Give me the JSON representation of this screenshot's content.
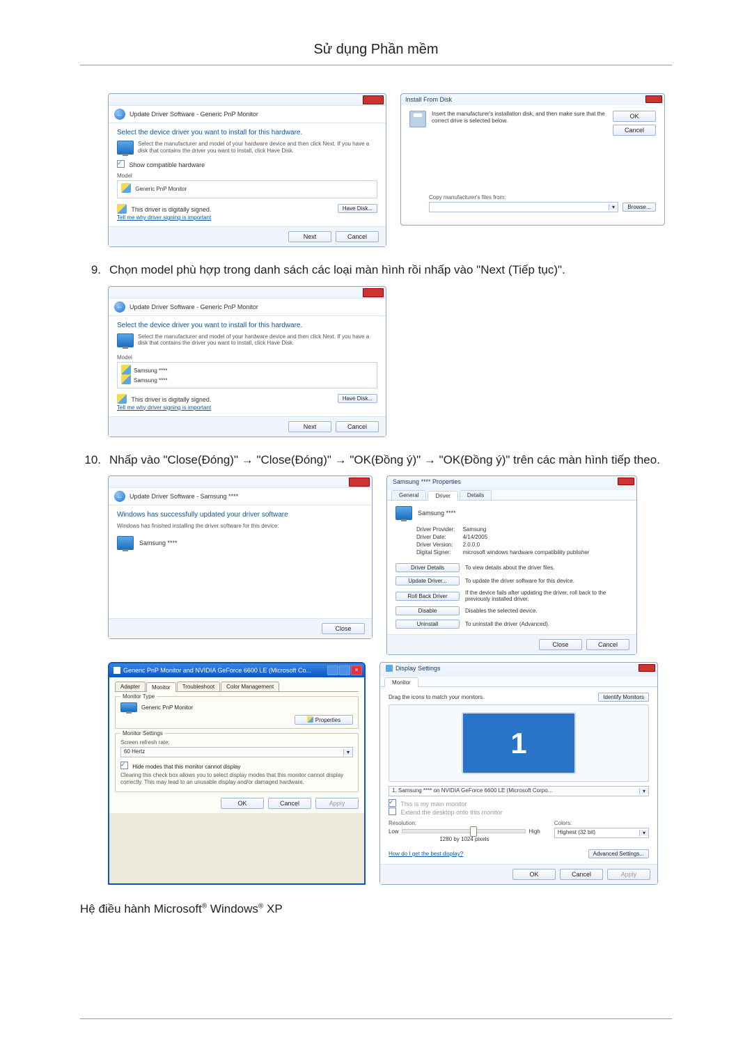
{
  "header": {
    "title": "Sử dụng Phần mềm"
  },
  "step9": {
    "num": "9.",
    "text": "Chọn model phù hợp trong danh sách các loại màn hình rồi nhấp vào \"Next (Tiếp tục)\"."
  },
  "step10": {
    "num": "10.",
    "text": "Nhấp vào \"Close(Đóng)\" → \"Close(Đóng)\" → \"OK(Đồng ý)\" → \"OK(Đồng ý)\" trên các màn hình tiếp theo."
  },
  "os_line_pre": "Hệ điều hành Microsoft",
  "os_line_mid": " Windows",
  "os_line_post": " XP",
  "reg": "®",
  "winA": {
    "title": "Update Driver Software - Generic PnP Monitor",
    "heading": "Select the device driver you want to install for this hardware.",
    "hint": "Select the manufacturer and model of your hardware device and then click Next. If you have a disk that contains the driver you want to install, click Have Disk.",
    "show_compat": "Show compatible hardware",
    "model_lbl": "Model",
    "model_item": "Generic PnP Monitor",
    "signed": "This driver is digitally signed.",
    "tell_me": "Tell me why driver signing is important",
    "have_disk": "Have Disk...",
    "next": "Next",
    "cancel": "Cancel"
  },
  "winB": {
    "title": "Install From Disk",
    "hint": "Insert the manufacturer's installation disk, and then make sure that the correct drive is selected below.",
    "ok": "OK",
    "cancel": "Cancel",
    "copy_lbl": "Copy manufacturer's files from:",
    "browse": "Browse..."
  },
  "winC": {
    "title": "Update Driver Software - Generic PnP Monitor",
    "heading": "Select the device driver you want to install for this hardware.",
    "hint": "Select the manufacturer and model of your hardware device and then click Next. If you have a disk that contains the driver you want to install, click Have Disk.",
    "model_lbl": "Model",
    "model_item1": "Samsung ****",
    "model_item2": "Samsung ****",
    "signed": "This driver is digitally signed.",
    "tell_me": "Tell me why driver signing is important",
    "have_disk": "Have Disk...",
    "next": "Next",
    "cancel": "Cancel"
  },
  "winD": {
    "title": "Update Driver Software - Samsung ****",
    "heading": "Windows has successfully updated your driver software",
    "sub": "Windows has finished installing the driver software for this device:",
    "device": "Samsung ****",
    "close": "Close"
  },
  "winE": {
    "title": "Samsung **** Properties",
    "tab_general": "General",
    "tab_driver": "Driver",
    "tab_details": "Details",
    "device": "Samsung ****",
    "prov_lbl": "Driver Provider:",
    "prov_val": "Samsung",
    "date_lbl": "Driver Date:",
    "date_val": "4/14/2005",
    "ver_lbl": "Driver Version:",
    "ver_val": "2.0.0.0",
    "signer_lbl": "Digital Signer:",
    "signer_val": "microsoft windows hardware compatibility publisher",
    "btn_details": "Driver Details",
    "txt_details": "To view details about the driver files.",
    "btn_update": "Update Driver...",
    "txt_update": "To update the driver software for this device.",
    "btn_rollback": "Roll Back Driver",
    "txt_rollback": "If the device fails after updating the driver, roll back to the previously installed driver.",
    "btn_disable": "Disable",
    "txt_disable": "Disables the selected device.",
    "btn_uninstall": "Uninstall",
    "txt_uninstall": "To uninstall the driver (Advanced).",
    "close": "Close",
    "cancel": "Cancel"
  },
  "winF": {
    "title": "Generic PnP Monitor and NVIDIA GeForce 6600 LE (Microsoft Co...",
    "tab_adapter": "Adapter",
    "tab_monitor": "Monitor",
    "tab_trouble": "Troubleshoot",
    "tab_color": "Color Management",
    "mt_lbl": "Monitor Type",
    "mt_val": "Generic PnP Monitor",
    "properties": "Properties",
    "ms_lbl": "Monitor Settings",
    "refresh_lbl": "Screen refresh rate:",
    "refresh_val": "60 Hertz",
    "hide_chk": "Hide modes that this monitor cannot display",
    "hide_txt": "Clearing this check box allows you to select display modes that this monitor cannot display correctly. This may lead to an unusable display and/or damaged hardware.",
    "ok": "OK",
    "cancel": "Cancel",
    "apply": "Apply"
  },
  "winG": {
    "title": "Display Settings",
    "tab_monitor": "Monitor",
    "drag": "Drag the icons to match your monitors.",
    "identify": "Identify Monitors",
    "big": "1",
    "sel": "1. Samsung **** on NVIDIA GeForce 6600 LE (Microsoft Corpo...",
    "main_chk": "This is my main monitor",
    "extend_chk": "Extend the desktop onto this monitor",
    "res_lbl": "Resolution:",
    "low": "Low",
    "high": "High",
    "res_val": "1280 by 1024 pixels",
    "colors_lbl": "Colors:",
    "colors_val": "Highest (32 bit)",
    "best": "How do I get the best display?",
    "adv": "Advanced Settings...",
    "ok": "OK",
    "cancel": "Cancel",
    "apply": "Apply"
  }
}
